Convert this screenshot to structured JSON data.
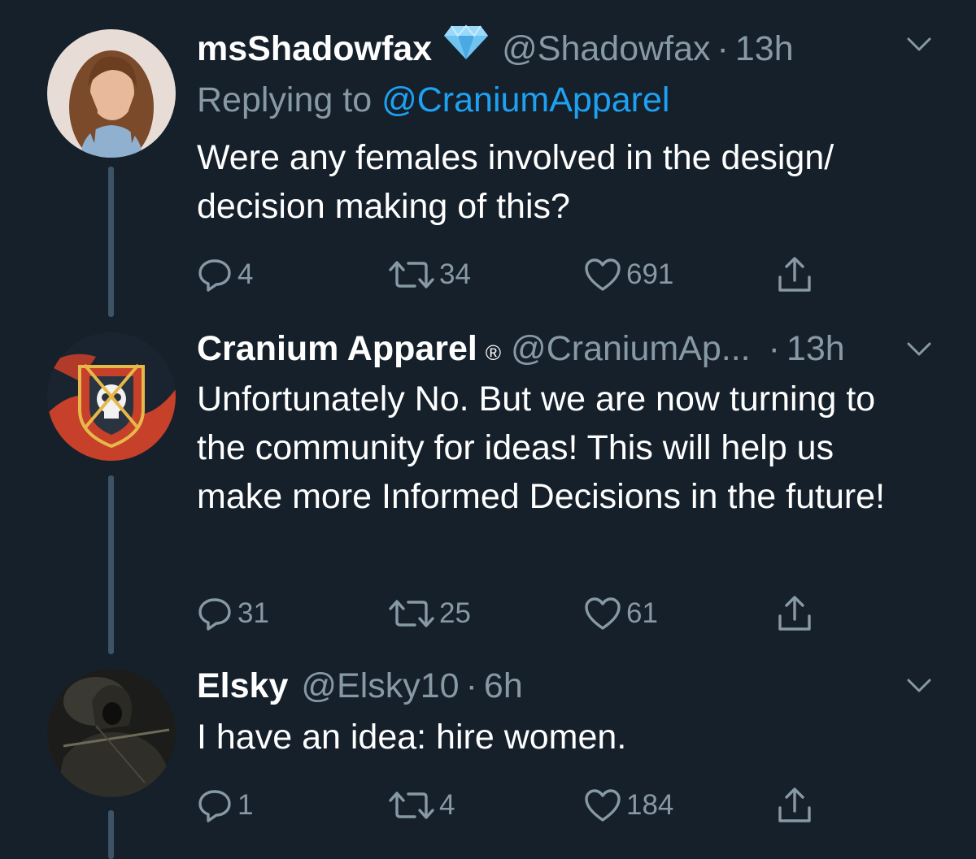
{
  "colors": {
    "background": "#15202b",
    "secondary_text": "#8899a6",
    "link": "#1da1f2",
    "thread_line": "#3d5466"
  },
  "tweets": [
    {
      "name": "msShadowfax",
      "badge_icon": "diamond-icon",
      "handle": "@Shadowfax",
      "dot": "·",
      "time": "13h",
      "replying_prefix": "Replying to",
      "replying_to": "@CraniumApparel",
      "text": "Were any females involved in the design/ decision making of this?",
      "replies": "4",
      "retweets": "34",
      "likes": "691"
    },
    {
      "name": "Cranium Apparel",
      "name_mark": "®",
      "handle": "@CraniumAp...",
      "dot": "·",
      "time": "13h",
      "text": "Unfortunately No. But we are now turning to the community for ideas! This will help us make more Informed Decisions in the future!",
      "replies": "31",
      "retweets": "25",
      "likes": "61"
    },
    {
      "name": "Elsky",
      "handle": "@Elsky10",
      "dot": "·",
      "time": "6h",
      "text": "I have an idea: hire women.",
      "replies": "1",
      "retweets": "4",
      "likes": "184"
    }
  ]
}
